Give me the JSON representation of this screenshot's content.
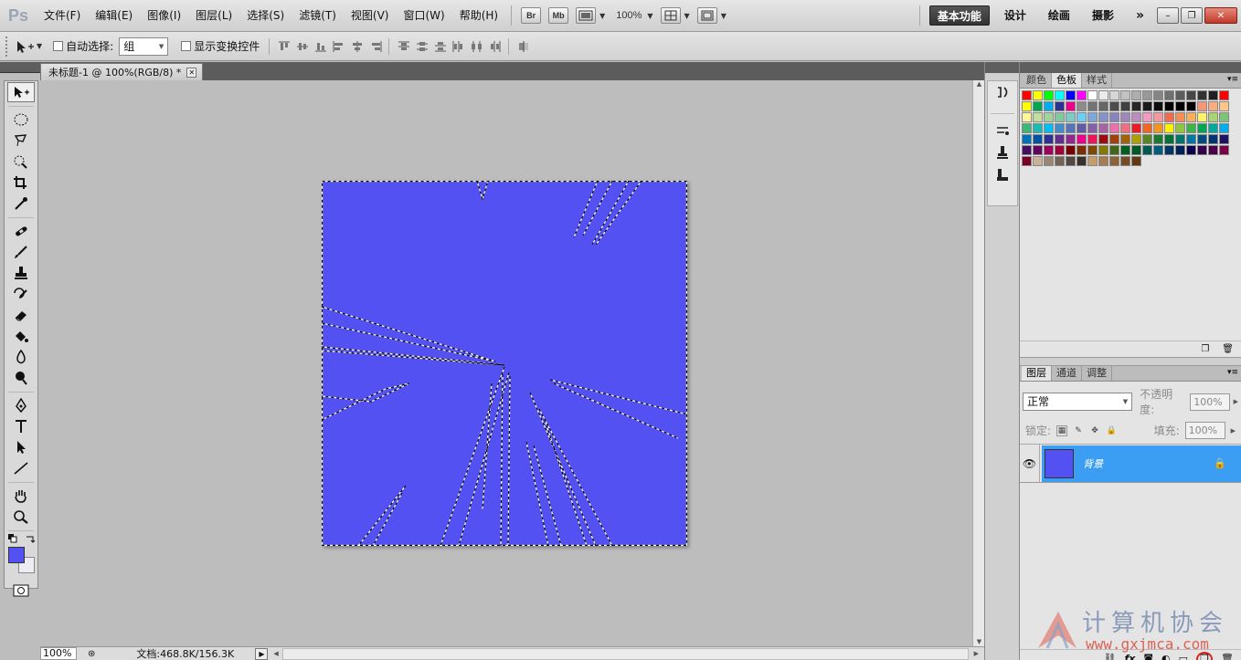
{
  "app": {
    "logo": "Ps",
    "menus": [
      "文件(F)",
      "编辑(E)",
      "图像(I)",
      "图层(L)",
      "选择(S)",
      "滤镜(T)",
      "视图(V)",
      "窗口(W)",
      "帮助(H)"
    ],
    "app_buttons": {
      "bridge": "Br",
      "minibridge": "Mb"
    },
    "zoom": "100%",
    "workspaces": [
      "基本功能",
      "设计",
      "绘画",
      "摄影"
    ],
    "workspace_more": "»",
    "window_buttons": {
      "minimize": "–",
      "restore": "❐",
      "close": "✕"
    }
  },
  "options_bar": {
    "auto_select_label": "自动选择:",
    "auto_select_value": "组",
    "show_transform_label": "显示变换控件"
  },
  "document": {
    "tab_title": "未标题-1 @ 100%(RGB/8) *",
    "tab_close": "✕",
    "canvas_color": "#5451f3"
  },
  "status_bar": {
    "zoom": "100%",
    "doc_info": "文档:468.8K/156.3K"
  },
  "swatch_panel": {
    "tabs": [
      "颜色",
      "色板",
      "样式"
    ],
    "active_tab": "色板",
    "colors": [
      "#ff0000",
      "#ffff00",
      "#00ff00",
      "#00ffff",
      "#0000ff",
      "#ff00ff",
      "#ffffff",
      "#ebebeb",
      "#d6d6d6",
      "#c2c2c2",
      "#adadad",
      "#999999",
      "#858585",
      "#707070",
      "#5c5c5c",
      "#474747",
      "#333333",
      "#1f1f1f",
      "#ff0000",
      "#ffff00",
      "#00a651",
      "#00aeef",
      "#2e3192",
      "#ec008c",
      "#8c8c8c",
      "#737373",
      "#666666",
      "#4d4d4d",
      "#404040",
      "#262626",
      "#1a1a1a",
      "#0d0d0d",
      "#000000",
      "#000000",
      "#000000",
      "#f7977a",
      "#f9ad81",
      "#fdc68a",
      "#fff79a",
      "#c4df9b",
      "#a3d39c",
      "#82ca9d",
      "#7bcdc8",
      "#6ecff6",
      "#7ea7d8",
      "#8493ca",
      "#8882be",
      "#a187be",
      "#bc8dbf",
      "#f49ac2",
      "#f6989d",
      "#f26c4f",
      "#f68e55",
      "#fbaf5c",
      "#fff467",
      "#acd372",
      "#7cc576",
      "#3bb878",
      "#1abbb4",
      "#00bff3",
      "#438ccb",
      "#5574b9",
      "#605ca8",
      "#855fa8",
      "#a763a8",
      "#f06ea9",
      "#f26d7d",
      "#ed1c24",
      "#f26522",
      "#f7941d",
      "#fff200",
      "#8dc63f",
      "#39b54a",
      "#00a651",
      "#00a99d",
      "#00aeef",
      "#0072bc",
      "#0054a6",
      "#2e3192",
      "#662d91",
      "#92278f",
      "#ec008c",
      "#ed145b",
      "#9e0b0f",
      "#a0410d",
      "#a36209",
      "#aba000",
      "#598527",
      "#1a7b30",
      "#007236",
      "#00746b",
      "#0076a3",
      "#004b80",
      "#003471",
      "#1b1464",
      "#440e62",
      "#630460",
      "#9e005d",
      "#9e0039",
      "#790000",
      "#7b2e00",
      "#7d4900",
      "#827b00",
      "#406618",
      "#005e20",
      "#005826",
      "#005952",
      "#005b7f",
      "#003663",
      "#002157",
      "#0d004c",
      "#32004b",
      "#4b0049",
      "#7b0046",
      "#7a0026",
      "#c7b299",
      "#998675",
      "#736357",
      "#534741",
      "#37302d",
      "#c69c6d",
      "#a67c52",
      "#8c6239",
      "#754c24",
      "#603913"
    ]
  },
  "layers_panel": {
    "tabs": [
      "图层",
      "通道",
      "调整"
    ],
    "active_tab": "图层",
    "blend_mode": "正常",
    "opacity_label": "不透明度:",
    "opacity": "100%",
    "lock_label": "锁定:",
    "fill_label": "填充:",
    "fill": "100%",
    "layers": [
      {
        "name": "背景",
        "visible": true,
        "locked": true,
        "selected": true
      }
    ]
  },
  "watermark": {
    "text": "计算机协会",
    "url": "www.gxjmca.com"
  }
}
